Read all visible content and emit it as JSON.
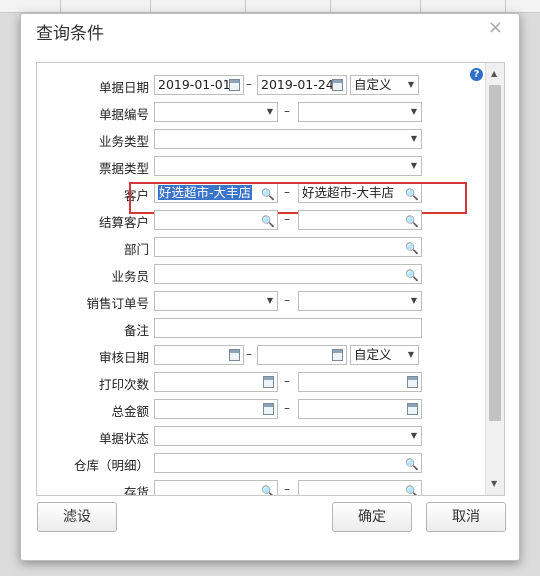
{
  "dialog": {
    "title": "查询条件",
    "close_symbol": "×",
    "help_symbol": "?"
  },
  "form": {
    "doc_date": {
      "label": "单据日期",
      "from": "2019-01-01",
      "to": "2019-01-24",
      "mode": "自定义"
    },
    "doc_no": {
      "label": "单据编号",
      "from": "",
      "to": ""
    },
    "biz_type": {
      "label": "业务类型",
      "value": ""
    },
    "ticket_type": {
      "label": "票据类型",
      "value": ""
    },
    "customer": {
      "label": "客户",
      "from": "好选超市-大丰店",
      "to": "好选超市-大丰店"
    },
    "settle_customer": {
      "label": "结算客户",
      "from": "",
      "to": ""
    },
    "department": {
      "label": "部门",
      "value": ""
    },
    "salesperson": {
      "label": "业务员",
      "value": ""
    },
    "sales_order_no": {
      "label": "销售订单号",
      "from": "",
      "to": ""
    },
    "remark": {
      "label": "备注",
      "value": ""
    },
    "audit_date": {
      "label": "审核日期",
      "from": "",
      "to": "",
      "mode": "自定义"
    },
    "print_count": {
      "label": "打印次数",
      "from": "",
      "to": ""
    },
    "total_amount": {
      "label": "总金额",
      "from": "",
      "to": ""
    },
    "doc_status": {
      "label": "单据状态",
      "value": ""
    },
    "warehouse": {
      "label": "仓库（明细）",
      "value": ""
    },
    "inventory": {
      "label": "存货",
      "from": "",
      "to": ""
    },
    "range_sep": "–"
  },
  "buttons": {
    "filter": "滤设",
    "ok": "确定",
    "cancel": "取消"
  },
  "colors": {
    "highlight_border": "#d5363a",
    "selection": "#3b75c9",
    "help": "#2f6ec9"
  }
}
